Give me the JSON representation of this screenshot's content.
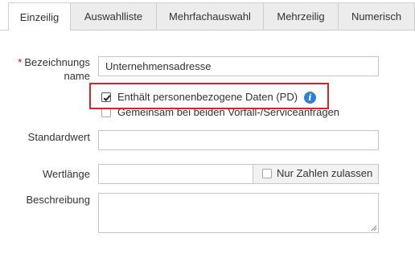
{
  "tabs": [
    {
      "label": "Einzeilig",
      "active": true
    },
    {
      "label": "Auswahlliste",
      "active": false
    },
    {
      "label": "Mehrfachauswahl",
      "active": false
    },
    {
      "label": "Mehrzeilig",
      "active": false
    },
    {
      "label": "Numerisch",
      "active": false
    }
  ],
  "form": {
    "name": {
      "required_marker": "*",
      "label": "Bezeichnungsname",
      "value": "Unternehmensadresse"
    },
    "pii": {
      "label": "Enthält personenbezogene Daten (PD)",
      "checked": true,
      "info_glyph": "i"
    },
    "shared": {
      "label": "Gemeinsam bei beiden Vorfall-/Serviceanfragen",
      "checked": false
    },
    "default_value": {
      "label": "Standardwert",
      "value": ""
    },
    "value_length": {
      "label": "Wertlänge",
      "value": "",
      "numbers_only_label": "Nur Zahlen zulassen",
      "numbers_only_checked": false
    },
    "description": {
      "label": "Beschreibung",
      "value": ""
    }
  },
  "colors": {
    "highlight": "#dd1f26",
    "info": "#2f7fd3",
    "required": "#cc0000"
  }
}
